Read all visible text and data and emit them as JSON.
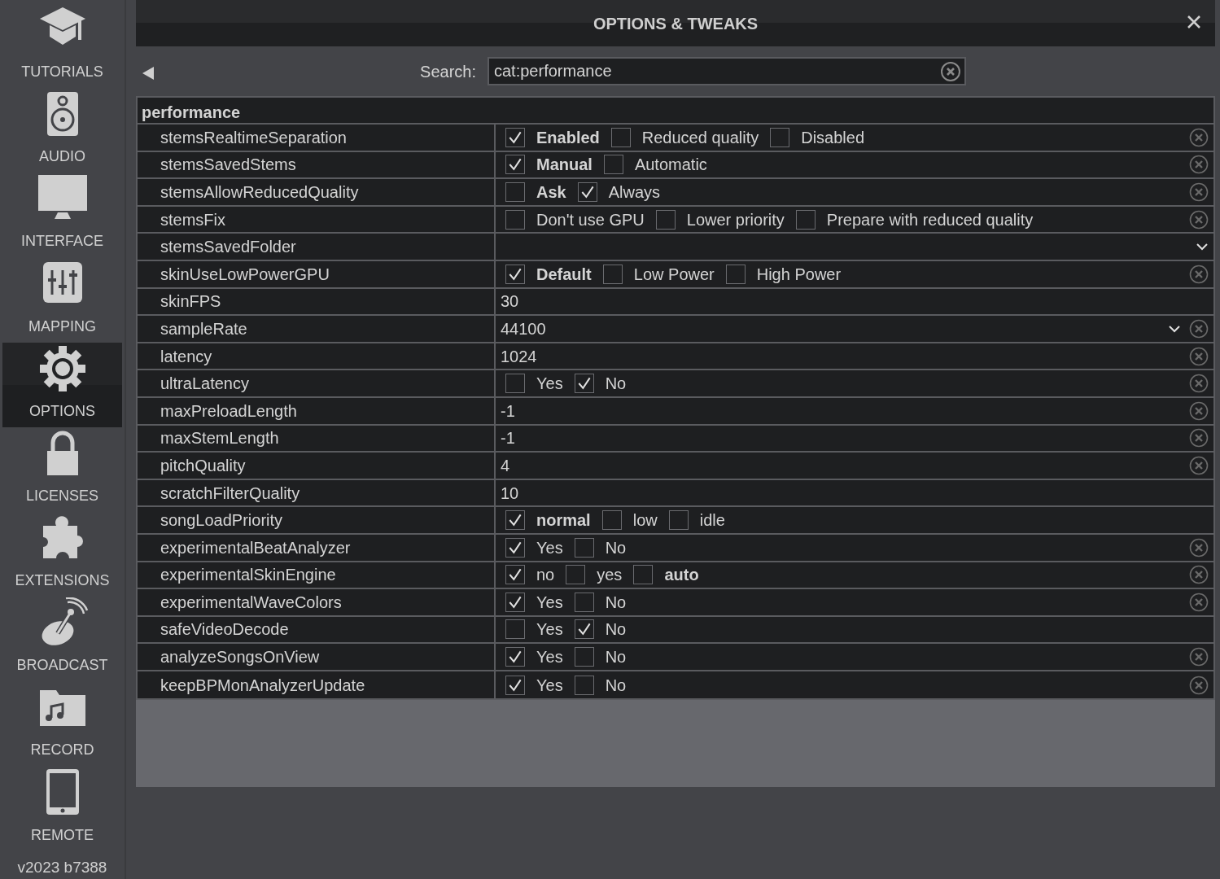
{
  "sidebar": {
    "items": [
      {
        "label": "TUTORIALS",
        "selected": false
      },
      {
        "label": "AUDIO",
        "selected": false
      },
      {
        "label": "INTERFACE",
        "selected": false
      },
      {
        "label": "MAPPING",
        "selected": false
      },
      {
        "label": "OPTIONS",
        "selected": true
      },
      {
        "label": "LICENSES",
        "selected": false
      },
      {
        "label": "EXTENSIONS",
        "selected": false
      },
      {
        "label": "BROADCAST",
        "selected": false
      },
      {
        "label": "RECORD",
        "selected": false
      },
      {
        "label": "REMOTE",
        "selected": false
      }
    ],
    "version": "v2023 b7388"
  },
  "window": {
    "title": "OPTIONS & TWEAKS"
  },
  "search": {
    "label": "Search:",
    "value": "cat:performance"
  },
  "table": {
    "category": "performance",
    "rows": [
      {
        "name": "stemsRealtimeSeparation",
        "kind": "checks",
        "reset": true,
        "options": [
          {
            "label": "Enabled",
            "checked": true,
            "default": true
          },
          {
            "label": "Reduced quality",
            "checked": false,
            "default": false
          },
          {
            "label": "Disabled",
            "checked": false,
            "default": false
          }
        ]
      },
      {
        "name": "stemsSavedStems",
        "kind": "checks",
        "reset": true,
        "options": [
          {
            "label": "Manual",
            "checked": true,
            "default": true
          },
          {
            "label": "Automatic",
            "checked": false,
            "default": false
          }
        ]
      },
      {
        "name": "stemsAllowReducedQuality",
        "kind": "checks",
        "reset": true,
        "options": [
          {
            "label": "Ask",
            "checked": false,
            "default": true
          },
          {
            "label": "Always",
            "checked": true,
            "default": false
          }
        ]
      },
      {
        "name": "stemsFix",
        "kind": "checks",
        "reset": true,
        "options": [
          {
            "label": "Don't use GPU",
            "checked": false,
            "default": false
          },
          {
            "label": "Lower priority",
            "checked": false,
            "default": false
          },
          {
            "label": "Prepare with reduced quality",
            "checked": false,
            "default": false
          }
        ]
      },
      {
        "name": "stemsSavedFolder",
        "kind": "select",
        "reset": false,
        "value": ""
      },
      {
        "name": "skinUseLowPowerGPU",
        "kind": "checks",
        "reset": true,
        "options": [
          {
            "label": "Default",
            "checked": true,
            "default": true
          },
          {
            "label": "Low Power",
            "checked": false,
            "default": false
          },
          {
            "label": "High Power",
            "checked": false,
            "default": false
          }
        ]
      },
      {
        "name": "skinFPS",
        "kind": "text",
        "reset": false,
        "value": "30"
      },
      {
        "name": "sampleRate",
        "kind": "select",
        "reset": true,
        "value": "44100"
      },
      {
        "name": "latency",
        "kind": "text",
        "reset": true,
        "value": "1024"
      },
      {
        "name": "ultraLatency",
        "kind": "checks",
        "reset": true,
        "options": [
          {
            "label": "Yes",
            "checked": false,
            "default": false
          },
          {
            "label": "No",
            "checked": true,
            "default": false
          }
        ]
      },
      {
        "name": "maxPreloadLength",
        "kind": "text",
        "reset": true,
        "value": "-1"
      },
      {
        "name": "maxStemLength",
        "kind": "text",
        "reset": true,
        "value": "-1"
      },
      {
        "name": "pitchQuality",
        "kind": "text",
        "reset": true,
        "value": "4"
      },
      {
        "name": "scratchFilterQuality",
        "kind": "text",
        "reset": false,
        "value": "10"
      },
      {
        "name": "songLoadPriority",
        "kind": "checks",
        "reset": false,
        "options": [
          {
            "label": "normal",
            "checked": true,
            "default": true
          },
          {
            "label": "low",
            "checked": false,
            "default": false
          },
          {
            "label": "idle",
            "checked": false,
            "default": false
          }
        ]
      },
      {
        "name": "experimentalBeatAnalyzer",
        "kind": "checks",
        "reset": true,
        "options": [
          {
            "label": "Yes",
            "checked": true,
            "default": false
          },
          {
            "label": "No",
            "checked": false,
            "default": false
          }
        ]
      },
      {
        "name": "experimentalSkinEngine",
        "kind": "checks",
        "reset": true,
        "options": [
          {
            "label": "no",
            "checked": true,
            "default": false
          },
          {
            "label": "yes",
            "checked": false,
            "default": false
          },
          {
            "label": "auto",
            "checked": false,
            "default": true
          }
        ]
      },
      {
        "name": "experimentalWaveColors",
        "kind": "checks",
        "reset": true,
        "options": [
          {
            "label": "Yes",
            "checked": true,
            "default": false
          },
          {
            "label": "No",
            "checked": false,
            "default": false
          }
        ]
      },
      {
        "name": "safeVideoDecode",
        "kind": "checks",
        "reset": false,
        "options": [
          {
            "label": "Yes",
            "checked": false,
            "default": false
          },
          {
            "label": "No",
            "checked": true,
            "default": false
          }
        ]
      },
      {
        "name": "analyzeSongsOnView",
        "kind": "checks",
        "reset": true,
        "options": [
          {
            "label": "Yes",
            "checked": true,
            "default": false
          },
          {
            "label": "No",
            "checked": false,
            "default": false
          }
        ]
      },
      {
        "name": "keepBPMonAnalyzerUpdate",
        "kind": "checks",
        "reset": true,
        "options": [
          {
            "label": "Yes",
            "checked": true,
            "default": false
          },
          {
            "label": "No",
            "checked": false,
            "default": false
          }
        ]
      }
    ]
  }
}
